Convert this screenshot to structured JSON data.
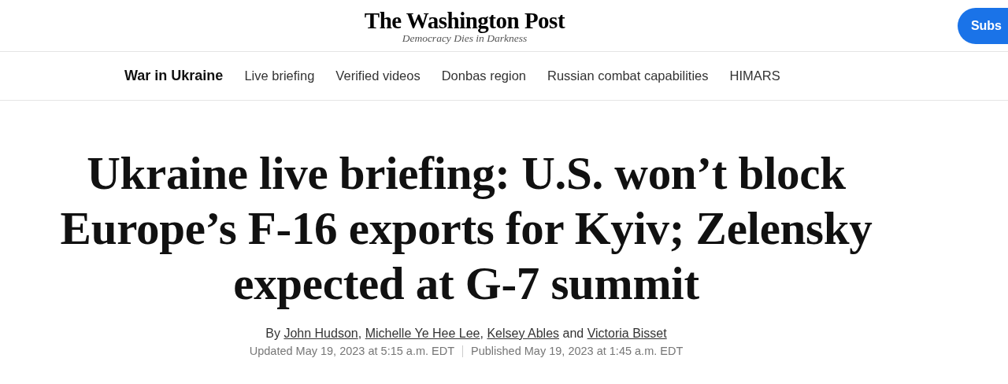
{
  "masthead": {
    "logo": "The Washington Post",
    "tagline": "Democracy Dies in Darkness",
    "subscribe_button": "Subs"
  },
  "nav": {
    "section": "War in Ukraine",
    "items": [
      {
        "label": "Live briefing"
      },
      {
        "label": "Verified videos"
      },
      {
        "label": "Donbas region"
      },
      {
        "label": "Russian combat capabilities"
      },
      {
        "label": "HIMARS"
      }
    ]
  },
  "article": {
    "headline": "Ukraine live briefing: U.S. won’t block Europe’s F-16 exports for Kyiv; Zelensky expected at G-7 summit",
    "byline": {
      "prefix": "By",
      "authors": [
        {
          "name": "John Hudson",
          "after": ","
        },
        {
          "name": "Michelle Ye Hee Lee",
          "after": ","
        },
        {
          "name": "Kelsey Ables",
          "after": " and"
        },
        {
          "name": "Victoria Bisset"
        }
      ]
    },
    "updated": "Updated May 19, 2023 at 5:15 a.m. EDT",
    "published": "Published May 19, 2023 at 1:45 a.m. EDT"
  }
}
